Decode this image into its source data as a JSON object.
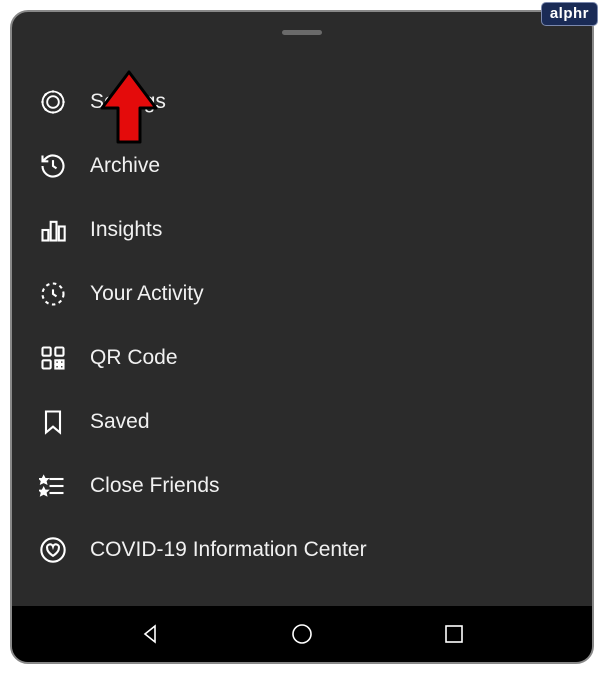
{
  "badge": {
    "label": "alphr"
  },
  "menu": {
    "items": [
      {
        "label": "Settings",
        "icon": "gear-icon"
      },
      {
        "label": "Archive",
        "icon": "history-icon"
      },
      {
        "label": "Insights",
        "icon": "bar-chart-icon"
      },
      {
        "label": "Your Activity",
        "icon": "clock-icon"
      },
      {
        "label": "QR Code",
        "icon": "qr-code-icon"
      },
      {
        "label": "Saved",
        "icon": "bookmark-icon"
      },
      {
        "label": "Close Friends",
        "icon": "list-star-icon"
      },
      {
        "label": "COVID-19 Information Center",
        "icon": "heart-circle-icon"
      }
    ]
  },
  "pointer": {
    "target": "settings"
  }
}
